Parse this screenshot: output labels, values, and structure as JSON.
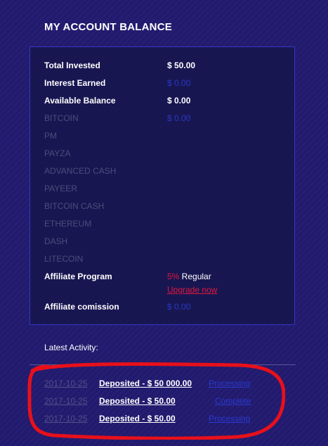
{
  "page": {
    "title": "MY ACCOUNT BALANCE",
    "latest_activity_label": "Latest Activity:"
  },
  "balance": {
    "total_invested": {
      "label": "Total Invested",
      "value": "$ 50.00"
    },
    "interest_earned": {
      "label": "Interest Earned",
      "value": "$ 0.00"
    },
    "available_balance": {
      "label": "Available Balance",
      "value": "$ 0.00"
    },
    "currencies": [
      {
        "label": "BITCOIN",
        "value": "$ 0.00"
      },
      {
        "label": "PM",
        "value": ""
      },
      {
        "label": "PAYZA",
        "value": ""
      },
      {
        "label": "ADVANCED CASH",
        "value": ""
      },
      {
        "label": "PAYEER",
        "value": ""
      },
      {
        "label": "BITCOIN CASH",
        "value": ""
      },
      {
        "label": "ETHEREUM",
        "value": ""
      },
      {
        "label": "DASH",
        "value": ""
      },
      {
        "label": "LITECOIN",
        "value": ""
      }
    ],
    "affiliate_program": {
      "label": "Affiliate Program",
      "percent": "5%",
      "level": " Regular",
      "upgrade": "Upgrade now"
    },
    "affiliate_commission": {
      "label": "Affiliate comission",
      "value": "$ 0.00"
    }
  },
  "activity": [
    {
      "date": "2017-10-25",
      "desc": "Deposited - $ 50 000.00",
      "status": "Processing"
    },
    {
      "date": "2017-10-25",
      "desc": "Deposited - $ 50.00",
      "status": "Complete"
    },
    {
      "date": "2017-10-25",
      "desc": "Deposited - $ 50.00",
      "status": "Processing"
    }
  ],
  "colors": {
    "background": "#221a6e",
    "panel_border": "#3535c8",
    "link_blue": "#2a3ad0",
    "accent_red": "#e0183c",
    "annotation_red": "#e8101a"
  }
}
